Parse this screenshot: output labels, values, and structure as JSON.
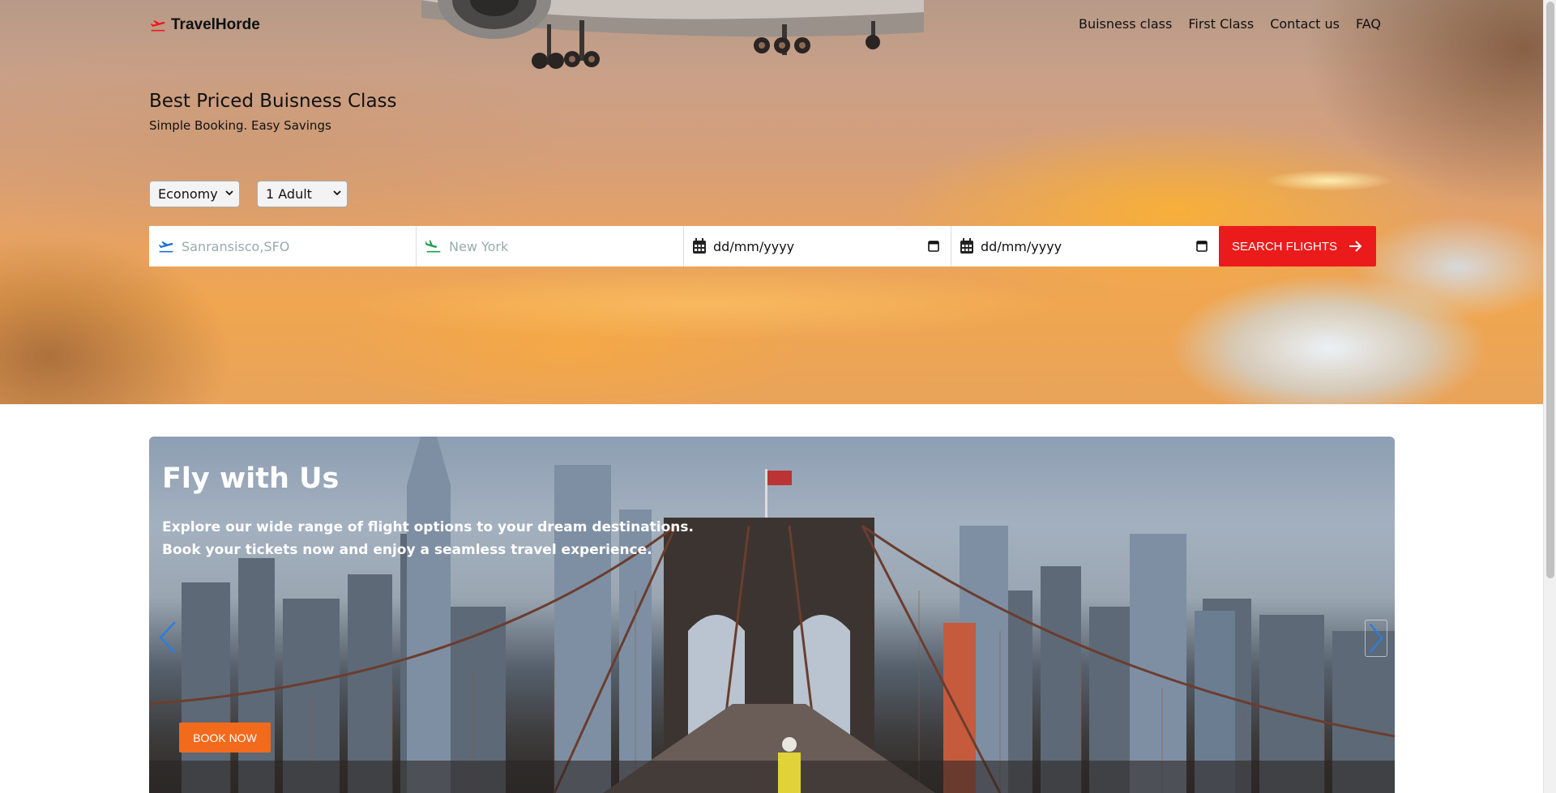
{
  "brand": {
    "name": "TravelHorde",
    "icon": "plane-takeoff-icon",
    "accent": "#ec1b1b"
  },
  "nav": {
    "items": [
      {
        "label": "Buisness class"
      },
      {
        "label": "First Class"
      },
      {
        "label": "Contact us"
      },
      {
        "label": "FAQ"
      }
    ]
  },
  "hero": {
    "title": "Best Priced Buisness Class",
    "subtitle": "Simple Booking. Easy Savings"
  },
  "search": {
    "cabin_class": "Economy",
    "passengers": "1 Adult",
    "from_placeholder": "Sanransisco,SFO",
    "to_placeholder": "New York",
    "depart_date": "dd/mm/yyyy",
    "return_date": "dd/mm/yyyy",
    "button_label": "SEARCH FLIGHTS",
    "button_color": "#ec1b1b"
  },
  "carousel": {
    "title": "Fly with Us",
    "text_line1": "Explore our wide range of flight options to your dream destinations.",
    "text_line2": "Book your tickets now and enjoy a seamless travel experience.",
    "cta_label": "BOOK NOW",
    "cta_color": "#f26b1d"
  }
}
